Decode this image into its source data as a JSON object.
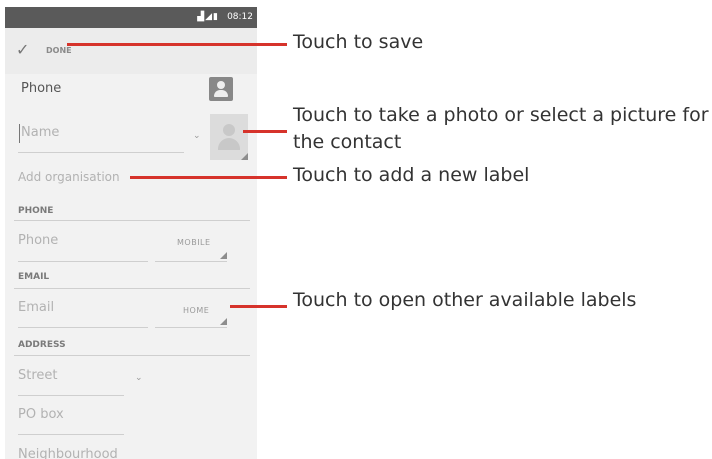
{
  "status_bar": {
    "time": "08:12",
    "icons": "▟◢▮"
  },
  "action_bar": {
    "done_label": "DONE",
    "done_icon": "checkmark-icon"
  },
  "account": {
    "label": "Phone",
    "icon": "contact-card-icon"
  },
  "name_field": {
    "placeholder": "Name"
  },
  "organisation": {
    "label": "Add organisation"
  },
  "phone_section": {
    "header": "PHONE",
    "placeholder": "Phone",
    "type_label": "MOBILE"
  },
  "email_section": {
    "header": "EMAIL",
    "placeholder": "Email",
    "type_label": "HOME"
  },
  "address_section": {
    "header": "ADDRESS",
    "street": "Street",
    "po_box": "PO box",
    "neighbourhood": "Neighbourhood"
  },
  "callouts": {
    "save": "Touch to save",
    "photo_line1": "Touch to take a photo or select a picture for",
    "photo_line2": "the contact",
    "label": "Touch to add a new label",
    "other_labels": "Touch to open other available labels"
  },
  "colors": {
    "callout_line": "#d6332b",
    "status_bar": "#5a5a5a",
    "screen_bg": "#f2f2f2"
  }
}
